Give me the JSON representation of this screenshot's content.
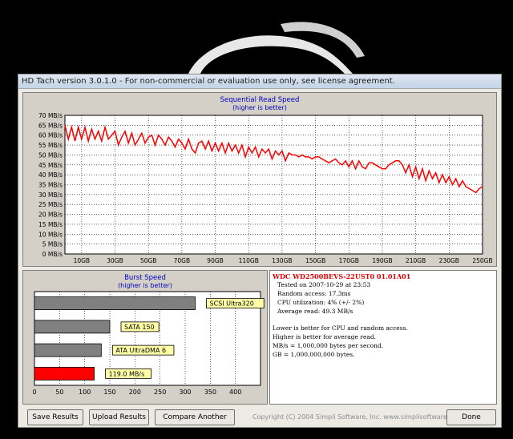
{
  "window": {
    "title": "HD Tach version 3.0.1.0  - For non-commercial or evaluation use only, see license agreement."
  },
  "read_chart": {
    "title": "Sequential Read Speed",
    "subtitle": "(higher is better)"
  },
  "burst_chart_text": {
    "title": "Burst Speed",
    "subtitle": "(higher is better)"
  },
  "chart_data": [
    {
      "type": "line",
      "title": "Sequential Read Speed",
      "subtitle": "(higher is better)",
      "y_ticks": [
        "0 MB/s",
        "5 MB/s",
        "10 MB/s",
        "15 MB/s",
        "20 MB/s",
        "25 MB/s",
        "30 MB/s",
        "35 MB/s",
        "40 MB/s",
        "45 MB/s",
        "50 MB/s",
        "55 MB/s",
        "60 MB/s",
        "65 MB/s",
        "70 MB/s"
      ],
      "x_ticks": [
        "10GB",
        "30GB",
        "50GB",
        "70GB",
        "90GB",
        "110GB",
        "130GB",
        "150GB",
        "170GB",
        "190GB",
        "210GB",
        "230GB",
        "250GB"
      ],
      "xlim": [
        0,
        250
      ],
      "ylim": [
        0,
        70
      ],
      "grid": true,
      "series": [
        {
          "color": "#ff0000",
          "x": [
            0,
            2,
            4,
            6,
            8,
            10,
            12,
            14,
            16,
            18,
            20,
            22,
            24,
            26,
            28,
            30,
            32,
            34,
            36,
            38,
            40,
            42,
            44,
            46,
            48,
            50,
            52,
            54,
            56,
            58,
            60,
            62,
            64,
            66,
            68,
            70,
            72,
            74,
            76,
            78,
            80,
            82,
            84,
            86,
            88,
            90,
            92,
            94,
            96,
            98,
            100,
            102,
            104,
            106,
            108,
            110,
            112,
            114,
            116,
            118,
            120,
            122,
            124,
            126,
            128,
            130,
            132,
            134,
            136,
            138,
            140,
            142,
            144,
            146,
            148,
            150,
            152,
            154,
            156,
            158,
            160,
            162,
            164,
            166,
            168,
            170,
            172,
            174,
            176,
            178,
            180,
            182,
            184,
            186,
            188,
            190,
            192,
            194,
            196,
            198,
            200,
            202,
            204,
            206,
            208,
            210,
            212,
            214,
            216,
            218,
            220,
            222,
            224,
            226,
            228,
            230,
            232,
            234,
            236,
            238,
            240,
            242,
            244,
            246,
            248,
            250
          ],
          "y": [
            65,
            58,
            64,
            57,
            64,
            58,
            64,
            57,
            63,
            58,
            62,
            57,
            64,
            58,
            60,
            62,
            55,
            59,
            62,
            56,
            61,
            55,
            58,
            61,
            56,
            59,
            60,
            55,
            60,
            58,
            55,
            59,
            57,
            54,
            58,
            56,
            53,
            58,
            53,
            51,
            56,
            57,
            53,
            57,
            52,
            56,
            52,
            56,
            51,
            56,
            52,
            55,
            51,
            55,
            49,
            54,
            51,
            54,
            49,
            53,
            51,
            53,
            48,
            52,
            50,
            52,
            47,
            51,
            50,
            50,
            49,
            50,
            49,
            49,
            48,
            49,
            49,
            48,
            47,
            46,
            47,
            48,
            46,
            45,
            47,
            44,
            47,
            43,
            47,
            44,
            43,
            46,
            46,
            45,
            44,
            43,
            43,
            45,
            46,
            47,
            47,
            45,
            41,
            45,
            39,
            44,
            38,
            43,
            37,
            42,
            38,
            41,
            36,
            40,
            36,
            39,
            35,
            38,
            34,
            37,
            34,
            33,
            32,
            31,
            33,
            34
          ]
        }
      ]
    },
    {
      "type": "bar",
      "title": "Burst Speed",
      "subtitle": "(higher is better)",
      "categories": [
        "SCSI Ultra320",
        "SATA 150",
        "ATA UltraDMA 6",
        "119.0 MB/s"
      ],
      "values": [
        320,
        150,
        133,
        119
      ],
      "colors": [
        "#808080",
        "#808080",
        "#808080",
        "#ff0000"
      ],
      "x_ticks": [
        "0",
        "50",
        "100",
        "150",
        "200",
        "250",
        "300",
        "350",
        "400"
      ],
      "xlim": [
        0,
        450
      ],
      "grid": true
    }
  ],
  "info": {
    "drive": "WDC  WD2500BEVS-22UST0 01.01A01",
    "tested": "Tested on 2007-10-29 at 23:53",
    "random_access": "Random access: 17.3ms",
    "cpu": "CPU utilization: 4% (+/- 2%)",
    "average": "Average read: 49.3 MB/s",
    "notes": [
      "Lower is better for CPU and random access.",
      "Higher is better for average read.",
      "MB/s = 1,000,000 bytes per second.",
      "GB = 1,000,000,000 bytes."
    ]
  },
  "buttons": {
    "save": "Save Results",
    "upload": "Upload Results",
    "compare": "Compare Another Drive",
    "done": "Done"
  },
  "copyright": "Copyright (C) 2004 Simpli Software, Inc. www.simplisoftware.com"
}
